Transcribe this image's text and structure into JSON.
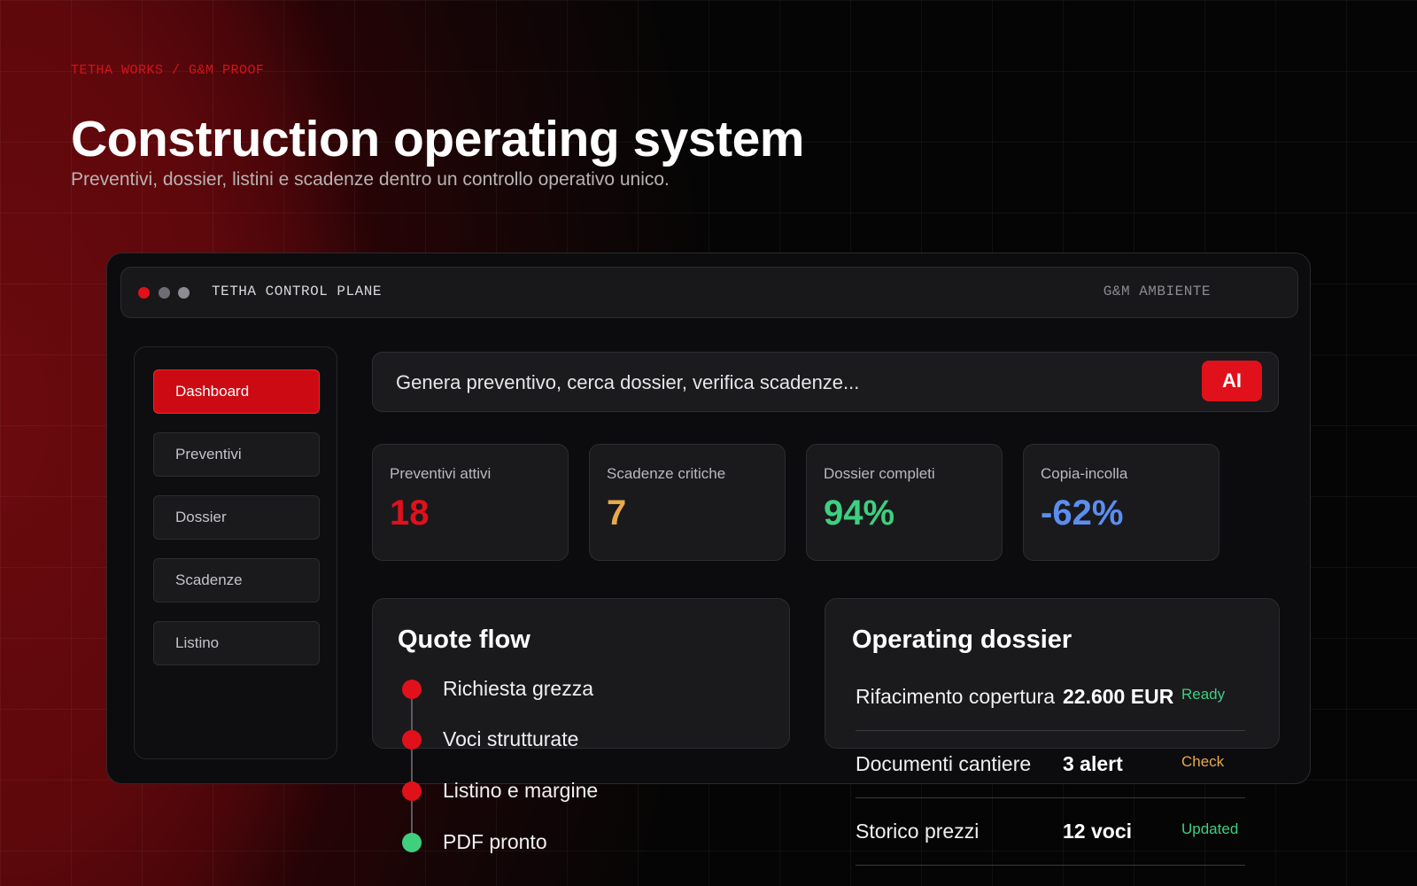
{
  "hero": {
    "kicker": "TETHA WORKS / G&M PROOF",
    "title": "Construction operating system",
    "subtitle": "Preventivi, dossier, listini e scadenze dentro un controllo operativo unico."
  },
  "window": {
    "title": "TETHA CONTROL PLANE",
    "environment": "G&M AMBIENTE"
  },
  "sidebar": {
    "items": [
      {
        "label": "Dashboard",
        "active": true
      },
      {
        "label": "Preventivi",
        "active": false
      },
      {
        "label": "Dossier",
        "active": false
      },
      {
        "label": "Scadenze",
        "active": false
      },
      {
        "label": "Listino",
        "active": false
      }
    ]
  },
  "command": {
    "placeholder": "Genera preventivo, cerca dossier, verifica scadenze...",
    "ai_label": "AI"
  },
  "stats": [
    {
      "label": "Preventivi attivi",
      "value": "18",
      "color": "#e0111b"
    },
    {
      "label": "Scadenze critiche",
      "value": "7",
      "color": "#e8a94a"
    },
    {
      "label": "Dossier completi",
      "value": "94%",
      "color": "#3ecf7f"
    },
    {
      "label": "Copia-incolla",
      "value": "-62%",
      "color": "#5b8ef0"
    }
  ],
  "quote_flow": {
    "title": "Quote flow",
    "steps": [
      {
        "label": "Richiesta grezza",
        "state": "active",
        "color": "#e0111b"
      },
      {
        "label": "Voci strutturate",
        "state": "active",
        "color": "#e0111b"
      },
      {
        "label": "Listino e margine",
        "state": "active",
        "color": "#e0111b"
      },
      {
        "label": "PDF pronto",
        "state": "done",
        "color": "#3ecf7f"
      }
    ]
  },
  "operating_dossier": {
    "title": "Operating dossier",
    "rows": [
      {
        "name": "Rifacimento copertura",
        "value": "22.600 EUR",
        "status": "Ready",
        "status_color": "#3ecf7f"
      },
      {
        "name": "Documenti cantiere",
        "value": "3 alert",
        "status": "Check",
        "status_color": "#e8a94a"
      },
      {
        "name": "Storico prezzi",
        "value": "12 voci",
        "status": "Updated",
        "status_color": "#3ecf7f"
      }
    ]
  }
}
